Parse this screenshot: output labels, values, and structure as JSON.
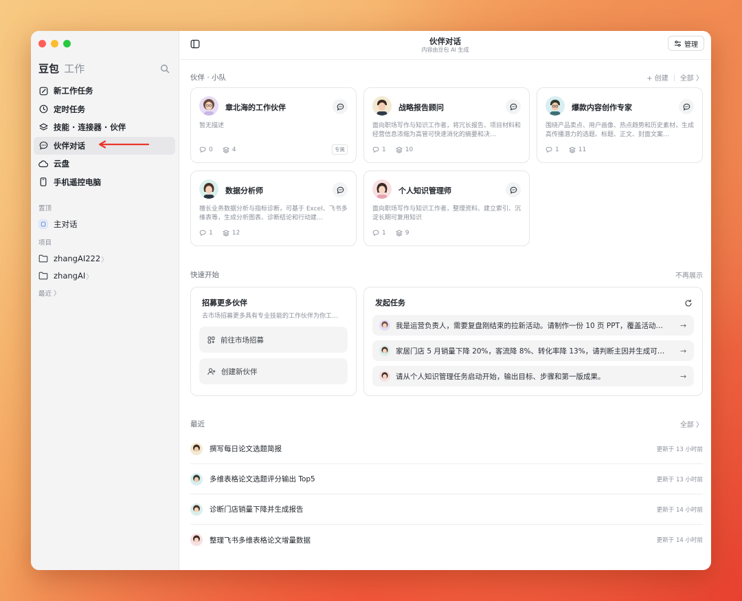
{
  "sidebar": {
    "brand": "豆包",
    "brand_sub": "工作",
    "nav": [
      {
        "label": "新工作任务",
        "icon": "edit-icon"
      },
      {
        "label": "定时任务",
        "icon": "clock-icon"
      },
      {
        "label": "技能 · 连接器 · 伙伴",
        "icon": "layers-icon"
      },
      {
        "label": "伙伴对话",
        "icon": "chat-icon"
      },
      {
        "label": "云盘",
        "icon": "cloud-icon"
      },
      {
        "label": "手机遥控电脑",
        "icon": "phone-icon"
      }
    ],
    "pinned_label": "置顶",
    "pinned_item": "主对话",
    "projects_label": "项目",
    "projects": [
      {
        "label": "zhangAI222",
        "chevron": "〉"
      },
      {
        "label": "zhangAI",
        "chevron": "〉"
      }
    ],
    "recent_label": "最近",
    "recent_chevron": "〉"
  },
  "topbar": {
    "title": "伙伴对话",
    "subtitle": "内容由豆包 AI 生成",
    "manage_label": "管理"
  },
  "partners": {
    "heading": "伙伴 · 小队",
    "create_label": "+ 创建",
    "all_label": "全部 〉",
    "cards": [
      {
        "name": "章北海的工作伙伴",
        "desc": "暂无描述",
        "chats": "0",
        "skills": "4",
        "tag": "专属"
      },
      {
        "name": "战略报告顾问",
        "desc": "面向职场写作与知识工作者，将冗长报告、项目材料和经营信息浓缩为高管可快速消化的摘要和决…",
        "chats": "1",
        "skills": "10",
        "tag": ""
      },
      {
        "name": "爆款内容创作专家",
        "desc": "围绕产品卖点、用户画像、热点趋势和历史素材，生成高传播潜力的选题、标题、正文、封面文案…",
        "chats": "1",
        "skills": "11",
        "tag": ""
      },
      {
        "name": "数据分析师",
        "desc": "擅长业务数据分析与指标诊断，可基于 Excel、飞书多维表等，生成分析图表、诊断结论和行动建…",
        "chats": "1",
        "skills": "12",
        "tag": ""
      },
      {
        "name": "个人知识管理师",
        "desc": "面向职场写作与知识工作者，整理资料、建立索引、沉淀长期可复用知识",
        "chats": "1",
        "skills": "9",
        "tag": ""
      }
    ]
  },
  "quickstart": {
    "heading": "快速开始",
    "dismiss_label": "不再展示",
    "recruit": {
      "title": "招募更多伙伴",
      "subtitle": "去市场招募更多具有专业技能的工作伙伴为你工…",
      "market_btn": "前往市场招募",
      "create_btn": "创建新伙伴"
    },
    "tasks": {
      "title": "发起任务",
      "items": [
        "我是运营负责人，需要复盘刚结束的拉新活动。请制作一份 10 页 PPT，覆盖活动…",
        "家居门店 5 月销量下降 20%，客流降 8%、转化率降 13%，请判断主因并生成可…",
        "请从个人知识管理任务启动开始，输出目标、步骤和第一版成果。"
      ]
    }
  },
  "recent": {
    "heading": "最近",
    "all_label": "全部 〉",
    "items": [
      {
        "title": "撰写每日论文选题简报",
        "time": "更新于 13 小时前"
      },
      {
        "title": "多维表格论文选题评分输出 Top5",
        "time": "更新于 13 小时前"
      },
      {
        "title": "诊断门店销量下降并生成报告",
        "time": "更新于 14 小时前"
      },
      {
        "title": "整理飞书多维表格论文增量数据",
        "time": "更新于 14 小时前"
      }
    ]
  },
  "colors": {
    "accent_arrow": "#e8372a",
    "sidebar_bg": "#f4f4f5"
  }
}
